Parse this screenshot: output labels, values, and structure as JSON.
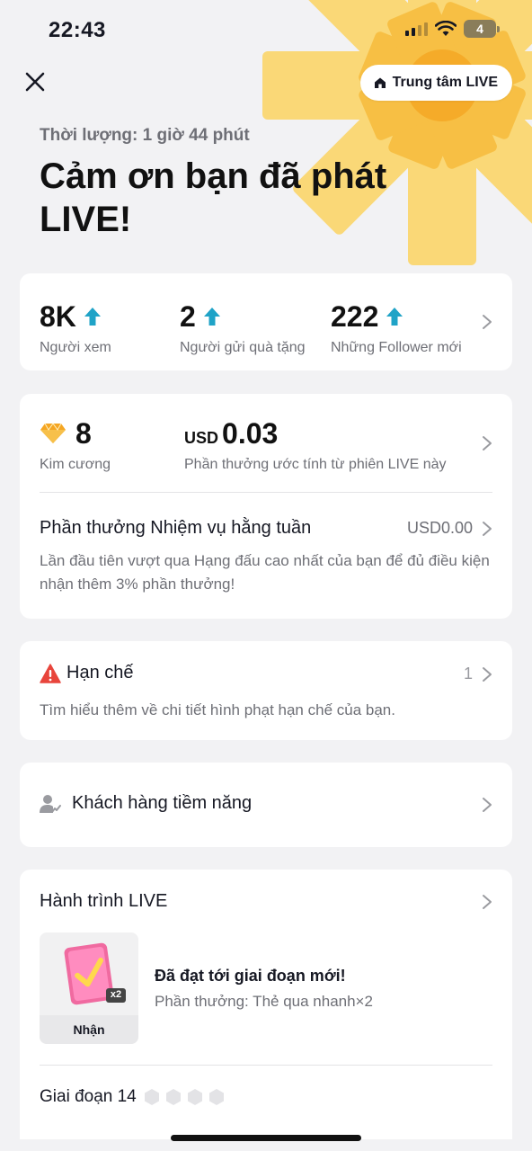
{
  "status_bar": {
    "time": "22:43",
    "battery": "4"
  },
  "header": {
    "live_center_label": "Trung tâm LIVE",
    "duration": "Thời lượng: 1 giờ 44 phút",
    "title": "Cảm ơn bạn đã phát LIVE!"
  },
  "stats": [
    {
      "value": "8K",
      "label": "Người xem"
    },
    {
      "value": "2",
      "label": "Người gửi quà tặng"
    },
    {
      "value": "222",
      "label": "Những Follower mới"
    }
  ],
  "earnings": {
    "diamonds_value": "8",
    "diamonds_label": "Kim cương",
    "usd_prefix": "USD",
    "usd_value": "0.03",
    "usd_label": "Phần thưởng ước tính từ phiên LIVE này",
    "weekly_title": "Phần thưởng Nhiệm vụ hằng tuần",
    "weekly_value": "USD0.00",
    "weekly_desc": "Lần đầu tiên vượt qua Hạng đấu cao nhất của bạn để đủ điều kiện nhận thêm 3% phần thưởng!"
  },
  "restriction": {
    "title": "Hạn chế",
    "count": "1",
    "desc": "Tìm hiểu thêm về chi tiết hình phạt hạn chế của bạn."
  },
  "prospects": {
    "title": "Khách hàng tiềm năng"
  },
  "journey": {
    "title": "Hành trình LIVE",
    "reward_badge": "x2",
    "claim_label": "Nhận",
    "milestone_title": "Đã đạt tới giai đoạn mới!",
    "milestone_desc": "Phần thưởng: Thẻ qua nhanh×2",
    "stage_label": "Giai đoạn 14"
  },
  "colors": {
    "accent_up": "#1fa3c7",
    "sunburst": "#f8c542",
    "warning": "#e8453c"
  }
}
